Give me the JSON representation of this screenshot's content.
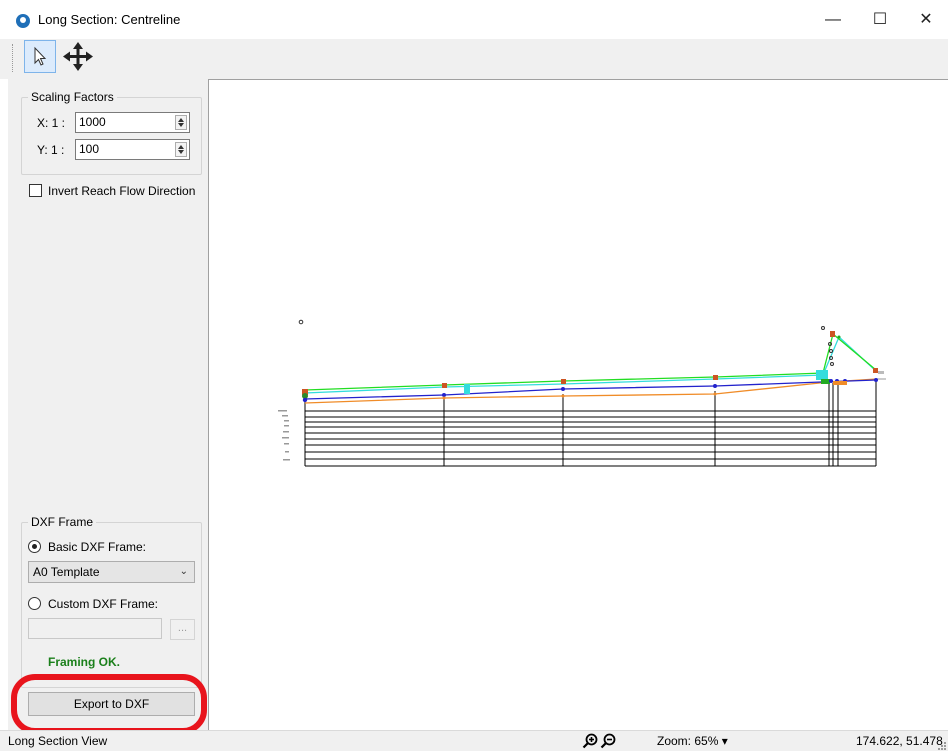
{
  "window": {
    "title": "Long Section: Centreline",
    "minimize_glyph": "—",
    "maximize_glyph": "☐",
    "close_glyph": "✕"
  },
  "toolbar": {
    "tools": [
      {
        "name": "select",
        "icon": "pointer-arrow-icon",
        "active": true
      },
      {
        "name": "pan",
        "icon": "four-way-arrow-icon",
        "active": false
      }
    ]
  },
  "scaling": {
    "title": "Scaling Factors",
    "x_label": "X: 1 :",
    "x_value": "1000",
    "y_label": "Y: 1 :",
    "y_value": "100"
  },
  "invert_flow": {
    "label": "Invert Reach Flow Direction",
    "checked": false
  },
  "dxf_frame": {
    "title": "DXF Frame",
    "basic_label": "Basic DXF Frame:",
    "basic_selected": true,
    "template_value": "A0 Template",
    "custom_label": "Custom DXF Frame:",
    "custom_path": "",
    "browse_label": "...",
    "status": "Framing OK.",
    "status_color": "#1a7f1a",
    "export_label": "Export to DXF"
  },
  "statusbar": {
    "view_label": "Long Section View",
    "zoom_label": "Zoom: 65% ▾",
    "coords": "174.622, 51.478"
  },
  "colors": {
    "highlight": "#e8141c",
    "ground_line": "#22dd22",
    "water_line": "#33dddd",
    "invert_line": "#2222cc",
    "soffit_line": "#f08c28",
    "node_marker": "#cc5522"
  }
}
